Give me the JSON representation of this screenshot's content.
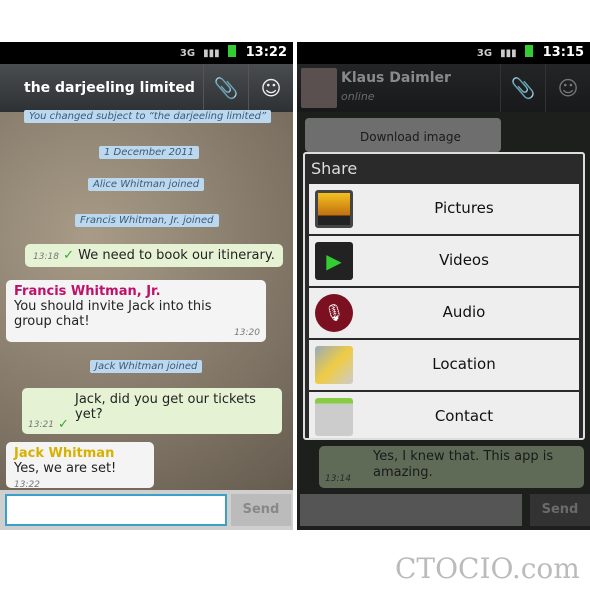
{
  "left": {
    "status_time": "13:22",
    "network": "3G",
    "title": "the darjeeling limited",
    "system_messages": [
      "You changed subject to “the darjeeling limited”",
      "1 December 2011",
      "Alice Whitman joined",
      "Francis Whitman, Jr. joined",
      "Jack Whitman joined"
    ],
    "messages": [
      {
        "text": "We need to book our itinerary.",
        "time": "13:18"
      },
      {
        "sender": "Francis Whitman, Jr.",
        "text": "You should invite Jack into this group chat!",
        "time": "13:20"
      },
      {
        "text": "Jack, did you get our tickets yet?",
        "time": "13:21"
      },
      {
        "sender": "Jack Whitman",
        "text": "Yes, we are set!",
        "time": "13:22"
      }
    ],
    "input_value": "",
    "send_label": "Send"
  },
  "right": {
    "status_time": "13:15",
    "network": "3G",
    "contact_name": "Klaus Daimler",
    "contact_status": "online",
    "bg_message": "Download image",
    "dialog_title": "Share",
    "share_items": [
      {
        "label": "Pictures",
        "icon": "pictures-icon"
      },
      {
        "label": "Videos",
        "icon": "videos-icon"
      },
      {
        "label": "Audio",
        "icon": "audio-icon"
      },
      {
        "label": "Location",
        "icon": "location-icon"
      },
      {
        "label": "Contact",
        "icon": "contact-icon"
      }
    ],
    "last_message": {
      "text": "Yes, I knew that. This app is amazing.",
      "time": "13:14"
    },
    "send_label": "Send"
  },
  "watermark": "CTOCIO.com",
  "colors": {
    "francis": "#c0106a",
    "jack": "#d8b000",
    "accent": "#3aa0c8"
  }
}
